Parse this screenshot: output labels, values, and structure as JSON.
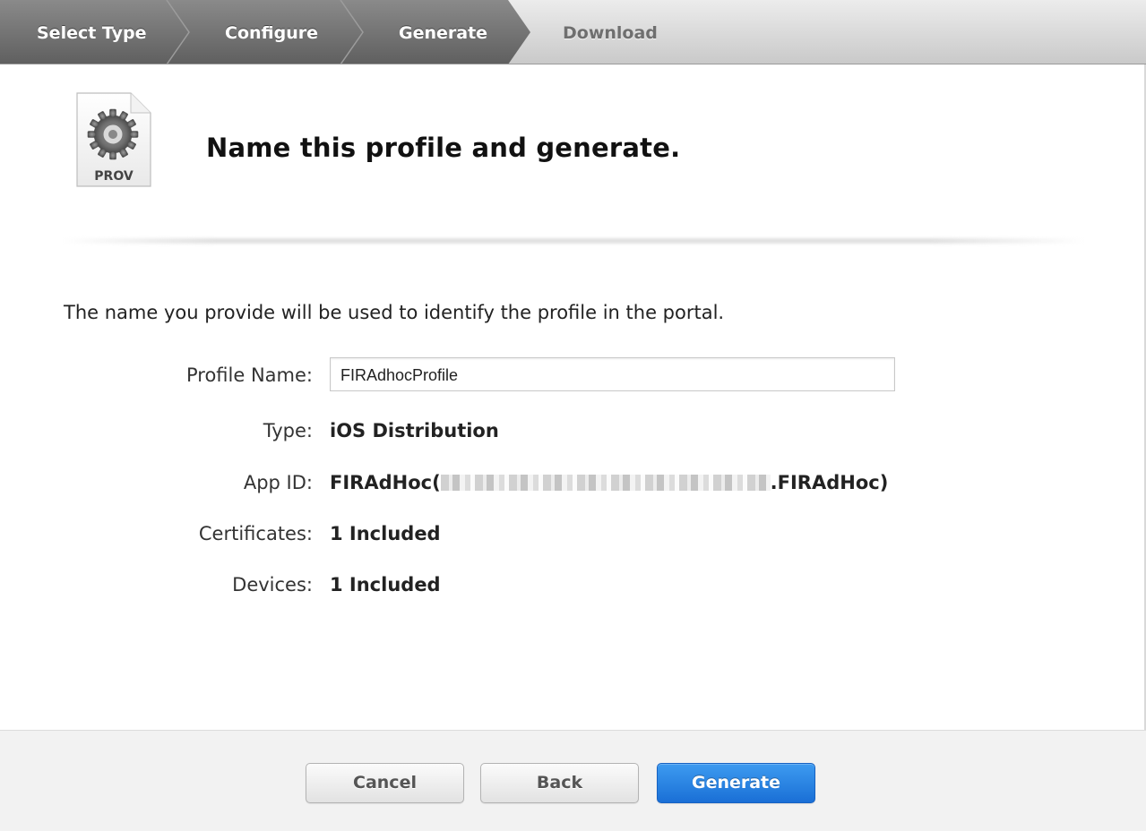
{
  "steps": [
    {
      "label": "Select Type",
      "state": "done"
    },
    {
      "label": "Configure",
      "state": "done"
    },
    {
      "label": "Generate",
      "state": "current"
    },
    {
      "label": "Download",
      "state": "todo"
    }
  ],
  "header": {
    "icon_text": "PROV",
    "icon": "provisioning-profile-gear-icon",
    "title": "Name this profile and generate."
  },
  "intro": "The name you provide will be used to identify the profile in the portal.",
  "form": {
    "profile_name_label": "Profile Name:",
    "profile_name_value": "FIRAdhocProfile",
    "type_label": "Type:",
    "type_value": "iOS Distribution",
    "app_id_label": "App ID:",
    "app_id_prefix": "FIRAdHoc(",
    "app_id_suffix": ".FIRAdHoc)",
    "certificates_label": "Certificates:",
    "certificates_value": "1 Included",
    "devices_label": "Devices:",
    "devices_value": "1 Included"
  },
  "buttons": {
    "cancel": "Cancel",
    "back": "Back",
    "generate": "Generate"
  },
  "colors": {
    "step_done": "#6b6b6b",
    "step_todo": "#d6d6d6",
    "primary_button": "#2a82e4"
  }
}
